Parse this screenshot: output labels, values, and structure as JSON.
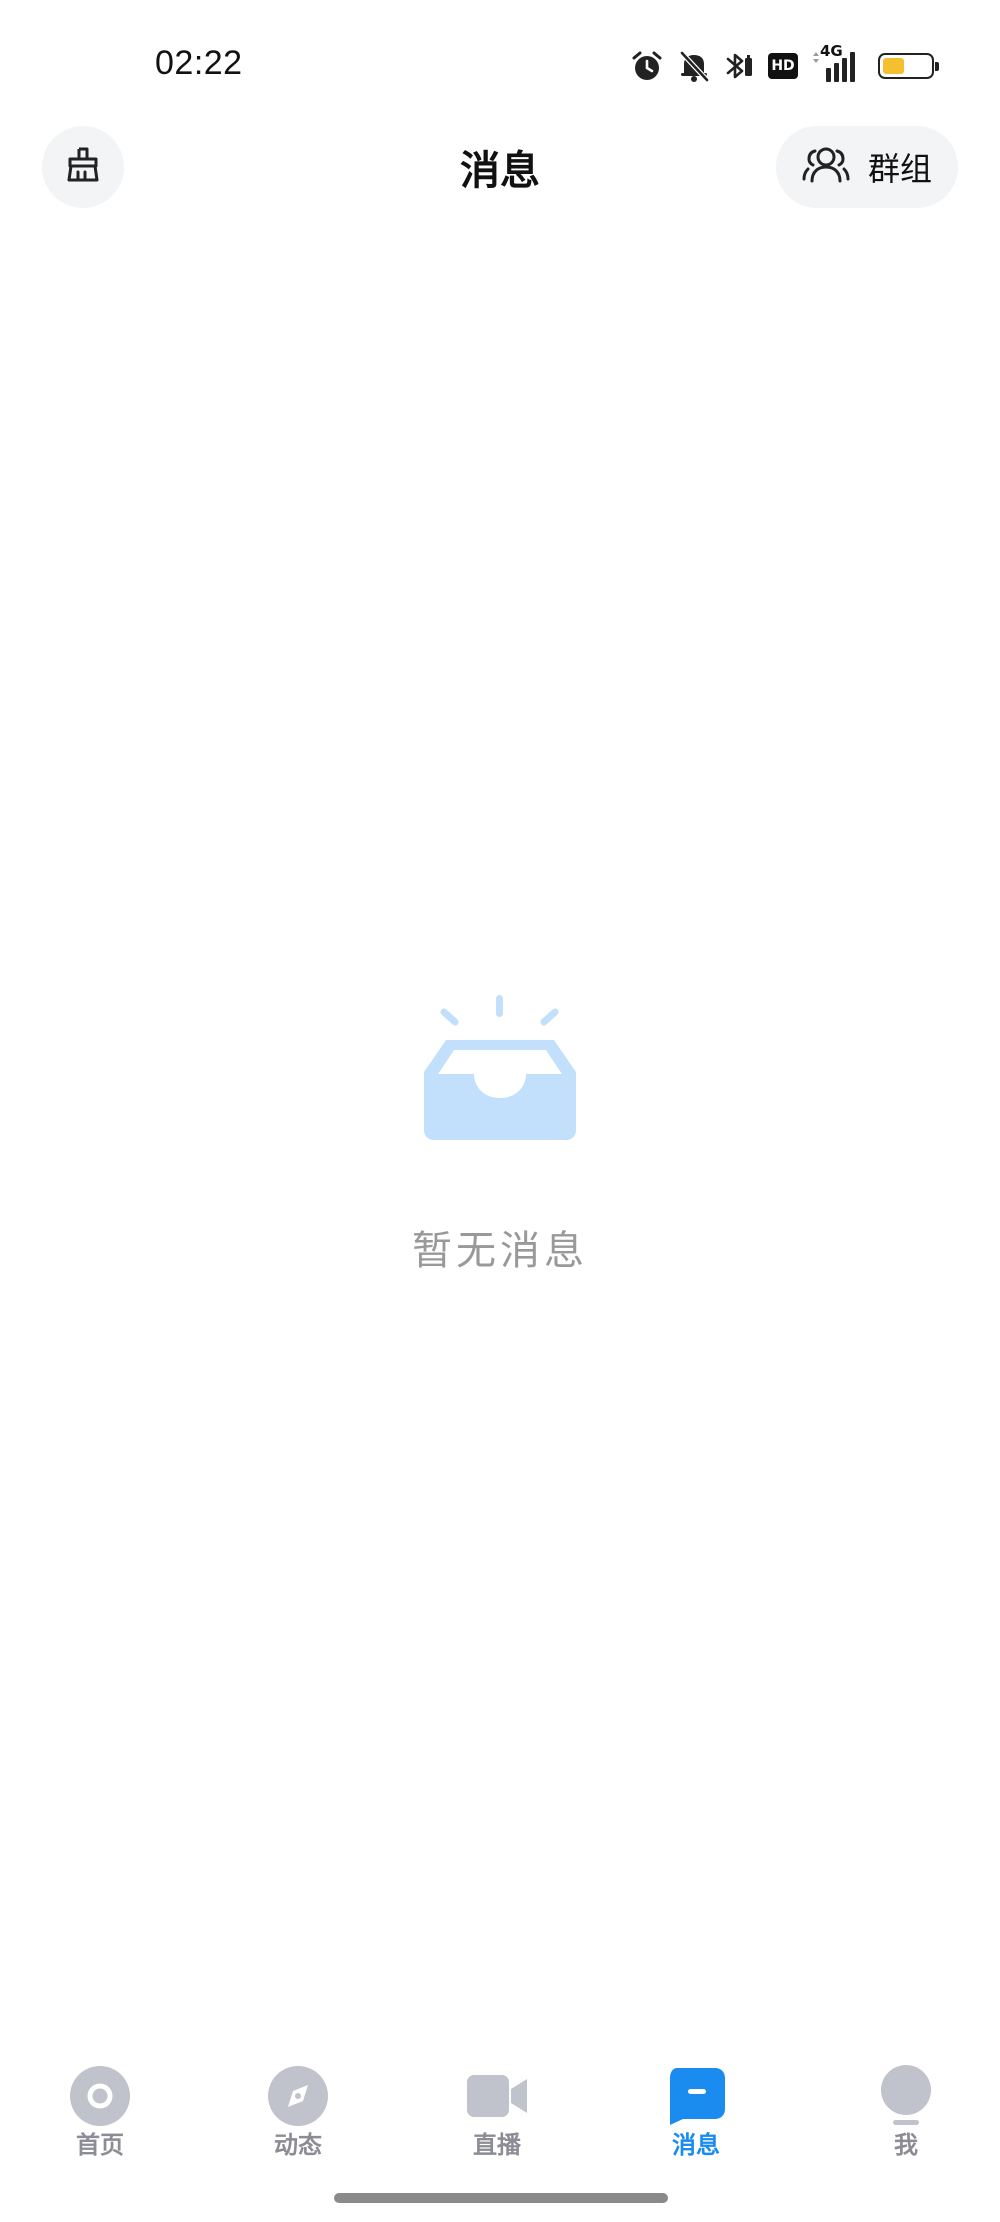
{
  "status_bar": {
    "time": "02:22",
    "network": "4G",
    "hd": "HD",
    "battery_level_percent": 45,
    "battery_color": "#f5c030",
    "icons": [
      "alarm-icon",
      "mute-bell-icon",
      "bluetooth-icon",
      "hd-icon",
      "signal-icon",
      "battery-icon"
    ]
  },
  "header": {
    "title": "消息",
    "left_icon": "broom-icon",
    "group_label": "群组",
    "group_icon": "users-icon"
  },
  "empty_state": {
    "icon": "empty-inbox-icon",
    "text": "暂无消息",
    "icon_color": "#c2dffb"
  },
  "nav": {
    "active_color": "#1a8cf0",
    "inactive_color": "#c0c2cc",
    "items": [
      {
        "label": "首页",
        "icon": "home-icon"
      },
      {
        "label": "动态",
        "icon": "compass-icon"
      },
      {
        "label": "直播",
        "icon": "video-camera-icon"
      },
      {
        "label": "消息",
        "icon": "chat-bubble-icon",
        "active": true
      },
      {
        "label": "我",
        "icon": "profile-icon"
      }
    ]
  }
}
